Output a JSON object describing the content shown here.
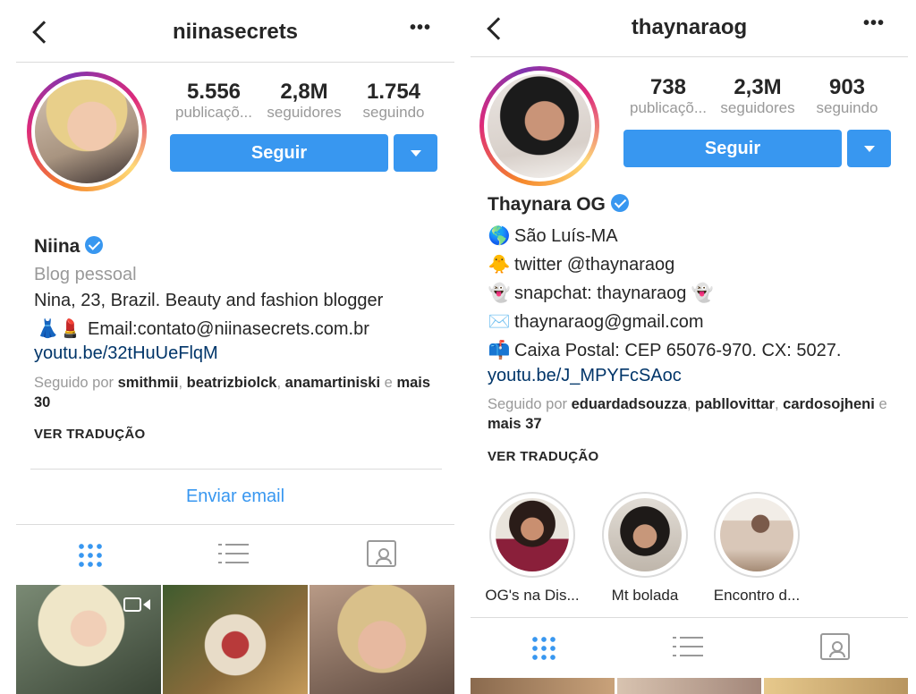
{
  "left": {
    "username": "niinasecrets",
    "stats": [
      {
        "value": "5.556",
        "label": "publicaçõ..."
      },
      {
        "value": "2,8M",
        "label": "seguidores"
      },
      {
        "value": "1.754",
        "label": "seguindo"
      }
    ],
    "follow_label": "Seguir",
    "display_name": "Niina",
    "category": "Blog pessoal",
    "bio": [
      {
        "emoji": "",
        "text": "Nina, 23, Brazil. Beauty and fashion blogger"
      },
      {
        "emoji": "👗💄",
        "text": "Email:contato@niinasecrets.com.br"
      }
    ],
    "link": "youtu.be/32tHuUeFlqM",
    "followed_by": {
      "prefix": "Seguido por",
      "names": [
        "smithmii",
        "beatrizbiolck",
        "anamartiniski"
      ],
      "and": "e",
      "more": "mais 30"
    },
    "translate": "VER TRADUÇÃO",
    "email_button": "Enviar email"
  },
  "right": {
    "username": "thaynaraog",
    "stats": [
      {
        "value": "738",
        "label": "publicaçõ..."
      },
      {
        "value": "2,3M",
        "label": "seguidores"
      },
      {
        "value": "903",
        "label": "seguindo"
      }
    ],
    "follow_label": "Seguir",
    "display_name": "Thaynara OG",
    "bio": [
      {
        "emoji": "🌎",
        "text": "São Luís-MA"
      },
      {
        "emoji": "🐥",
        "text": "twitter @thaynaraog"
      },
      {
        "emoji": "👻",
        "text": "snapchat: thaynaraog 👻"
      },
      {
        "emoji": "✉️",
        "text": "thaynaraog@gmail.com"
      },
      {
        "emoji": "📫",
        "text": "Caixa Postal: CEP 65076-970. CX: 5027."
      }
    ],
    "link": "youtu.be/J_MPYFcSAoc",
    "followed_by": {
      "prefix": "Seguido por",
      "names": [
        "eduardadsouzza",
        "pabllovittar",
        "cardosojheni"
      ],
      "and": "e",
      "more": "mais 37"
    },
    "translate": "VER TRADUÇÃO",
    "highlights": [
      {
        "label": "OG's na Dis..."
      },
      {
        "label": "Mt bolada"
      },
      {
        "label": "Encontro d..."
      }
    ]
  },
  "icons": [
    "back-arrow-icon",
    "more-options-icon",
    "verified-badge-icon",
    "dropdown-arrow-icon",
    "grid-view-icon",
    "list-view-icon",
    "tagged-photos-icon",
    "video-icon"
  ],
  "colors": {
    "accent": "#3897f0",
    "link": "#003569",
    "muted": "#999999",
    "divider": "#dbdbdb"
  }
}
